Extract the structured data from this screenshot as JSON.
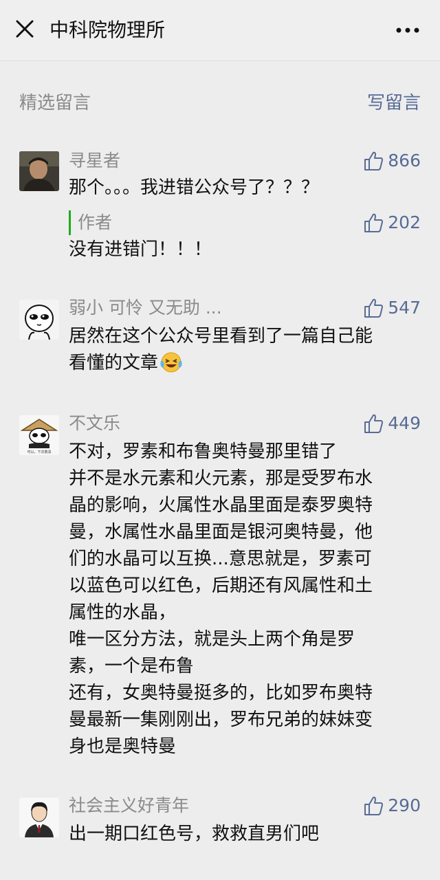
{
  "header": {
    "title": "中科院物理所"
  },
  "section": {
    "title": "精选留言",
    "write_label": "写留言"
  },
  "comments": [
    {
      "name": "寻星者",
      "likes": "866",
      "text": "那个。。。我进错公众号了？？？",
      "reply": {
        "tag": "作者",
        "likes": "202",
        "text": "没有进错门！！！"
      }
    },
    {
      "name": "弱小 可怜 又无助 ...",
      "likes": "547",
      "text": "居然在这个公众号里看到了一篇自己能\n看懂的文章"
    },
    {
      "name": "不文乐",
      "likes": "449",
      "text": "不对，罗素和布鲁奥特曼那里错了\n并不是水元素和火元素，那是受罗布水\n晶的影响，火属性水晶里面是泰罗奥特\n曼，水属性水晶里面是银河奥特曼，他\n们的水晶可以互换...意思就是，罗素可\n以蓝色可以红色，后期还有风属性和土\n属性的水晶，\n唯一区分方法，就是头上两个角是罗\n素，一个是布鲁\n还有，女奥特曼挺多的，比如罗布奥特\n曼最新一集刚刚出，罗布兄弟的妹妹变\n身也是奥特曼"
    },
    {
      "name": "社会主义好青年",
      "likes": "290",
      "text": "出一期口红色号，救救直男们吧"
    }
  ],
  "avatars": {
    "c4_caption": "可以，下次救清"
  },
  "colors": {
    "link": "#576b95",
    "meta": "#8a8a8a",
    "author_bar": "#1aad19",
    "background": "#ededed"
  },
  "icons": [
    "close-icon",
    "more-icon",
    "thumbs-up-icon",
    "laughing-crying-emoji"
  ]
}
